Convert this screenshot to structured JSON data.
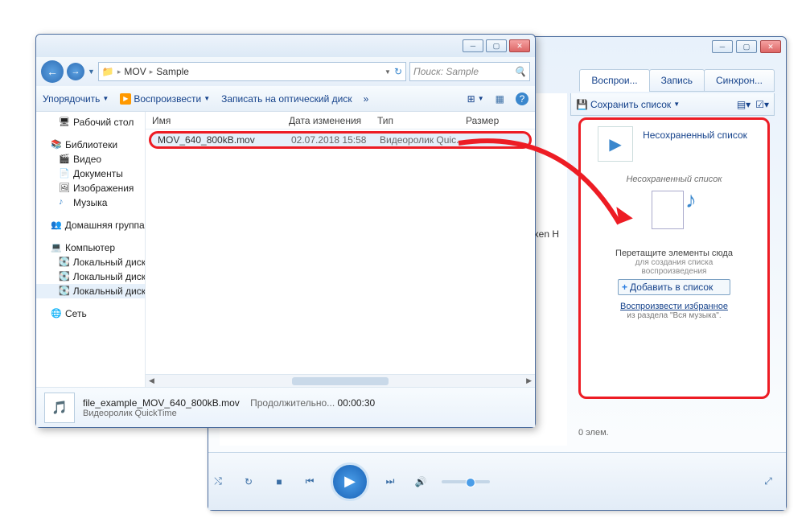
{
  "wmp": {
    "tabs": {
      "play": "Воспрои...",
      "record": "Запись",
      "sync": "Синхрон..."
    },
    "toolbar": {
      "save_list": "Сохранить список"
    },
    "dropzone": {
      "title": "Несохраненный список",
      "subtitle": "Несохраненный список",
      "drag_msg": "Перетащите элементы сюда",
      "drag_hint1": "для создания списка",
      "drag_hint2": "воспроизведения",
      "add_btn": "Добавить в список",
      "fav_link": "Воспроизвести избранное",
      "fav_src": "из раздела \"Вся музыка\"."
    },
    "count": "0 элем.",
    "content_item": "axen H"
  },
  "explorer": {
    "breadcrumb": {
      "seg1": "MOV",
      "seg2": "Sample"
    },
    "search_placeholder": "Поиск: Sample",
    "toolbar": {
      "organize": "Упорядочить",
      "play": "Воспроизвести",
      "burn": "Записать на оптический диск"
    },
    "tree": {
      "desktop": "Рабочий стол",
      "libraries": "Библиотеки",
      "video": "Видео",
      "documents": "Документы",
      "images": "Изображения",
      "music": "Музыка",
      "homegroup": "Домашняя группа",
      "computer": "Компьютер",
      "drive1": "Локальный диск",
      "drive2": "Локальный диск",
      "drive3": "Локальный диск",
      "network": "Сеть"
    },
    "columns": {
      "name": "Имя",
      "date": "Дата изменения",
      "type": "Тип",
      "size": "Размер"
    },
    "file": {
      "name": "MOV_640_800kB.mov",
      "date": "02.07.2018 15:58",
      "type": "Видеоролик Quic..."
    },
    "status": {
      "filename": "file_example_MOV_640_800kB.mov",
      "dur_label": "Продолжительно...",
      "duration": "00:00:30",
      "filetype": "Видеоролик QuickTime"
    }
  }
}
